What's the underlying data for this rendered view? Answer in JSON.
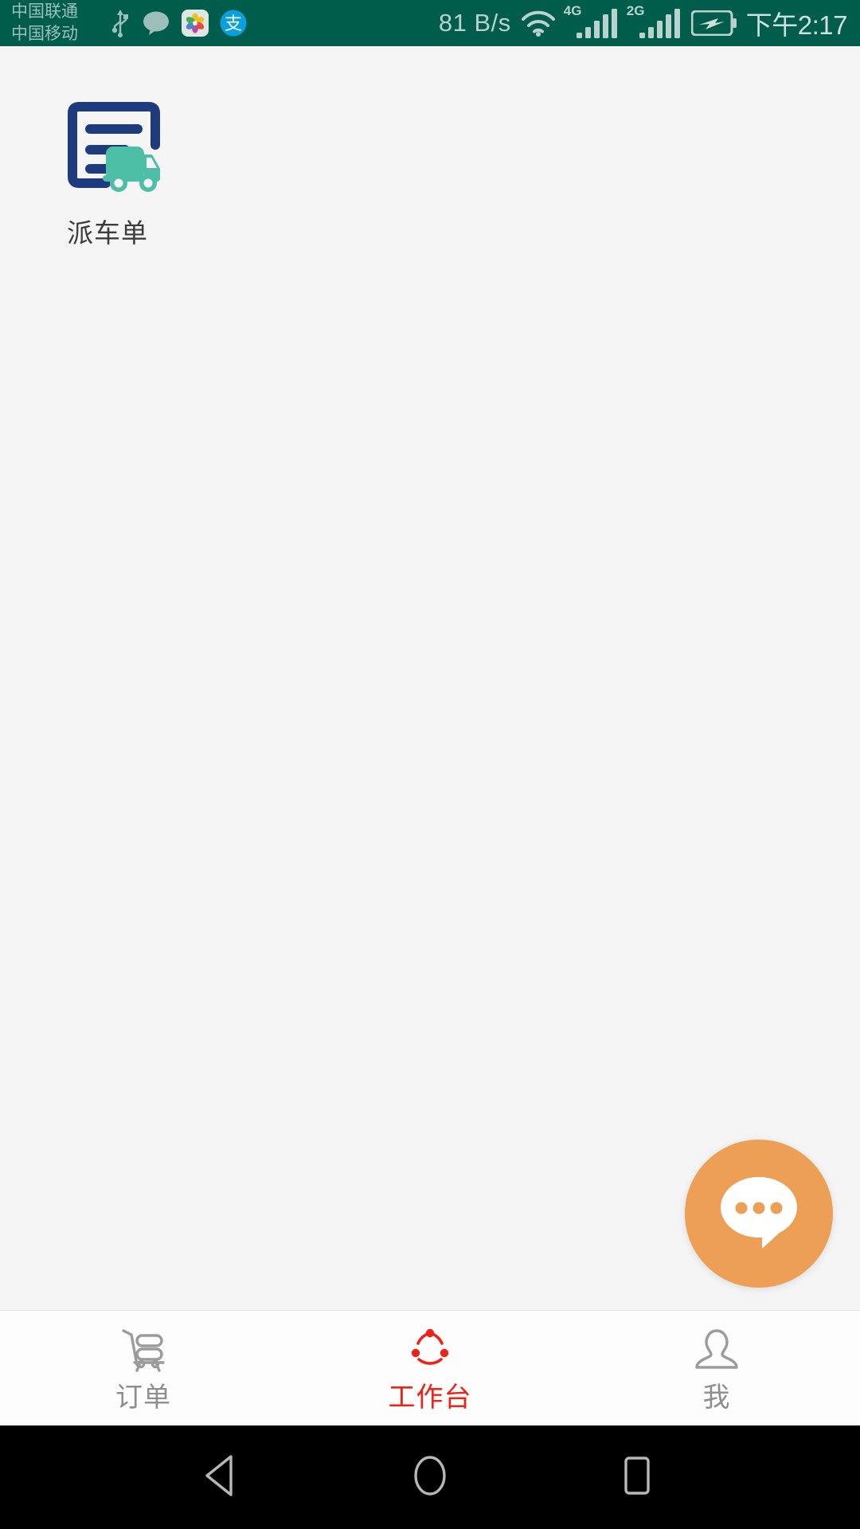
{
  "status_bar": {
    "carrier_primary": "中国联通",
    "carrier_secondary": "中国移动",
    "icons": [
      "usb-icon",
      "message-bubble-icon",
      "photos-app-icon",
      "alipay-icon"
    ],
    "network_speed": "81 B/s",
    "wifi": "wifi-icon",
    "signal_1_label": "4G",
    "signal_2_label": "2G",
    "battery": "battery-charging-icon",
    "clock": "下午2:17",
    "background_color": "#005d4c",
    "text_color": "#b9d2cd"
  },
  "workspace": {
    "apps": [
      {
        "label": "派车单",
        "icon": "dispatch-order-truck-icon",
        "doc_color": "#1e3b7d",
        "truck_color": "#4cbfa6"
      }
    ],
    "background_color": "#f5f5f6"
  },
  "fab": {
    "icon": "chat-bubble-dots-icon",
    "color": "#eda055",
    "dot_count": 3
  },
  "tab_bar": {
    "active_color": "#f02216",
    "inactive_color": "#8e8e8e",
    "background_color": "#fdfdfd",
    "tabs": [
      {
        "label": "订单",
        "icon": "shopping-cart-icon",
        "active": false
      },
      {
        "label": "工作台",
        "icon": "workbench-dots-circle-icon",
        "active": true
      },
      {
        "label": "我",
        "icon": "person-icon",
        "active": false
      }
    ]
  },
  "android_nav": {
    "background_color": "#000000",
    "buttons": [
      {
        "name": "back",
        "icon": "triangle-back-icon"
      },
      {
        "name": "home",
        "icon": "circle-home-icon"
      },
      {
        "name": "recents",
        "icon": "square-recents-icon"
      }
    ]
  }
}
